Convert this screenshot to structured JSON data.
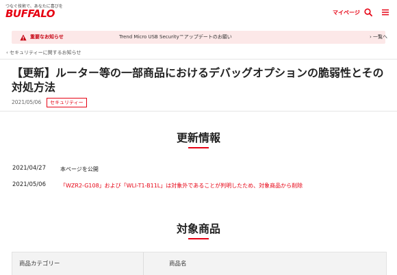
{
  "header": {
    "tagline": "つなぐ技術で、あなたに喜びを",
    "logo": "BUFFALO",
    "mypage": "マイページ"
  },
  "notice": {
    "label": "重要なお知らせ",
    "text": "Trend Micro USB Security™アップデートのお願い",
    "all": "一覧へ"
  },
  "breadcrumb": "セキュリティーに関するお知らせ",
  "article": {
    "title": "【更新】ルーター等の一部商品におけるデバッグオプションの脆弱性とその対処方法",
    "date": "2021/05/06",
    "category": "セキュリティー"
  },
  "updates": {
    "heading": "更新情報",
    "entries": [
      {
        "date": "2021/04/27",
        "text": "本ページを公開"
      },
      {
        "date": "2021/05/06",
        "text": "「WZR2-G108」および「WLI-T1-B11L」は対象外であることが判明したため、対象商品から削除"
      }
    ]
  },
  "products": {
    "heading": "対象商品",
    "columns": [
      "商品カテゴリー",
      "商品名"
    ]
  },
  "colors": {
    "accent": "#e60012",
    "notice_bg": "#fce8e8"
  }
}
